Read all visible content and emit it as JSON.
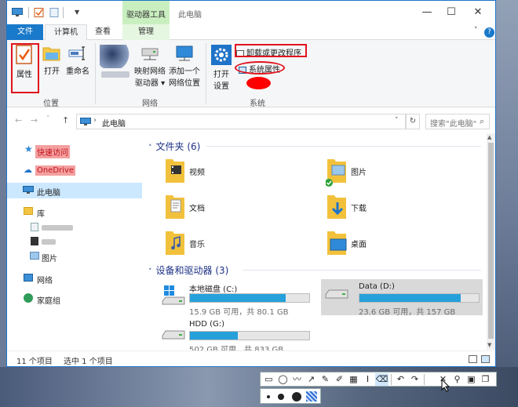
{
  "titlebar": {
    "context_tab_label": "驱动器工具",
    "window_title": "此电脑",
    "minimize": "—",
    "maximize": "☐",
    "close": "✕"
  },
  "ribbon_tabs": {
    "file": "文件",
    "computer": "计算机",
    "view": "查看",
    "manage": "管理",
    "collapse": "˅",
    "help": "?"
  },
  "ribbon": {
    "location_group": {
      "label": "位置",
      "properties": "属性",
      "open": "打开",
      "rename": "重命名"
    },
    "network_group": {
      "label": "网络",
      "map_drive_line1": "映射网络",
      "map_drive_line2": "驱动器 ▾",
      "add_location_line1": "添加一个",
      "add_location_line2": "网络位置"
    },
    "system_group": {
      "label": "系统",
      "open_settings_line1": "打开",
      "open_settings_line2": "设置",
      "uninstall": "卸载或更改程序",
      "system_properties": "系统属性"
    }
  },
  "address": {
    "back": "←",
    "forward": "→",
    "dropdown": "˅",
    "up": "↑",
    "path_sep": "›",
    "path": "此电脑",
    "addr_dropdown": "˅",
    "refresh": "↻",
    "search_placeholder": "搜索\"此电脑\"",
    "search_icon": "⌕"
  },
  "navpane": {
    "quick_access": "快速访问",
    "onedrive": "OneDrive",
    "this_pc": "此电脑",
    "libraries": "库",
    "pictures": "图片",
    "network": "网络",
    "homegroup": "家庭组"
  },
  "content": {
    "folders_header": "文件夹 (6)",
    "folders": [
      {
        "name": "视频",
        "icon": "video-folder"
      },
      {
        "name": "图片",
        "icon": "pictures-folder"
      },
      {
        "name": "文档",
        "icon": "documents-folder"
      },
      {
        "name": "下载",
        "icon": "downloads-folder"
      },
      {
        "name": "音乐",
        "icon": "music-folder"
      },
      {
        "name": "桌面",
        "icon": "desktop-folder"
      }
    ],
    "drives_header": "设备和驱动器 (3)",
    "drives": [
      {
        "name": "本地磁盘 (C:)",
        "info": "15.9 GB 可用，共 80.1 GB",
        "used_fraction": 0.8
      },
      {
        "name": "Data (D:)",
        "info": "23.6 GB 可用，共 157 GB",
        "used_fraction": 0.85
      },
      {
        "name": "HDD (G:)",
        "info": "502 GB 可用，共 833 GB",
        "used_fraction": 0.4
      }
    ]
  },
  "statusbar": {
    "item_count": "11 个项目",
    "selected": "选中 1 个项目"
  },
  "snip_toolbar": {
    "tools": [
      "rectangle",
      "ellipse",
      "polyline",
      "arrow",
      "pen",
      "marker",
      "mosaic",
      "text",
      "eraser",
      "undo",
      "redo",
      "cancel",
      "pin",
      "save",
      "copy"
    ]
  },
  "colors": {
    "accent": "#1979ca",
    "highlight_red": "#e0141e",
    "drive_bar": "#26a0da",
    "context_tab": "#c9efc0"
  }
}
